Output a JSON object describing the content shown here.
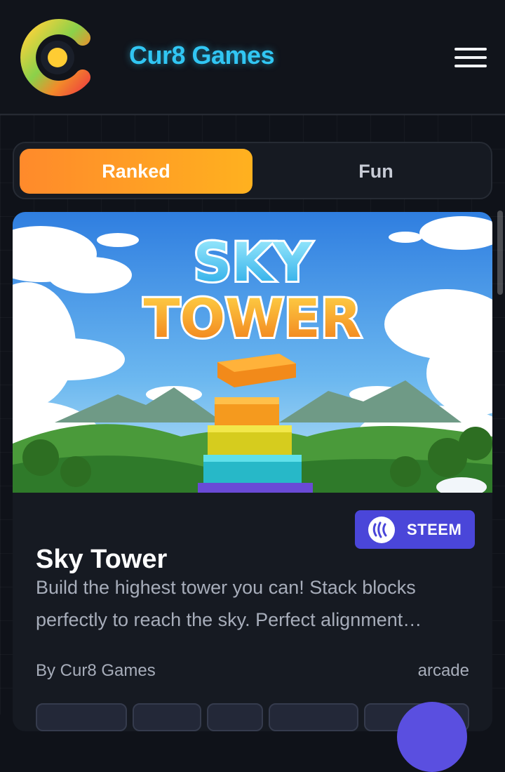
{
  "header": {
    "brand": "Cur8 Games",
    "logo_icon": "cur8-logo-icon",
    "menu_icon": "hamburger-menu-icon"
  },
  "tabs": [
    {
      "label": "Ranked",
      "active": true
    },
    {
      "label": "Fun",
      "active": false
    }
  ],
  "game_card": {
    "hero_title_line1": "SKY",
    "hero_title_line2": "TOWER",
    "title": "Sky Tower",
    "chain_badge": {
      "label": "STEEM",
      "icon": "steem-icon"
    },
    "description": "Build the highest tower you can! Stack blocks perfectly to reach the sky. Perfect alignment…",
    "author": "By Cur8 Games",
    "genre": "arcade"
  },
  "colors": {
    "background": "#0f1219",
    "brand_cyan": "#31c6f3",
    "tab_active_start": "#ff8a2b",
    "tab_active_end": "#ffb11f",
    "badge_purple": "#4a46d9"
  }
}
